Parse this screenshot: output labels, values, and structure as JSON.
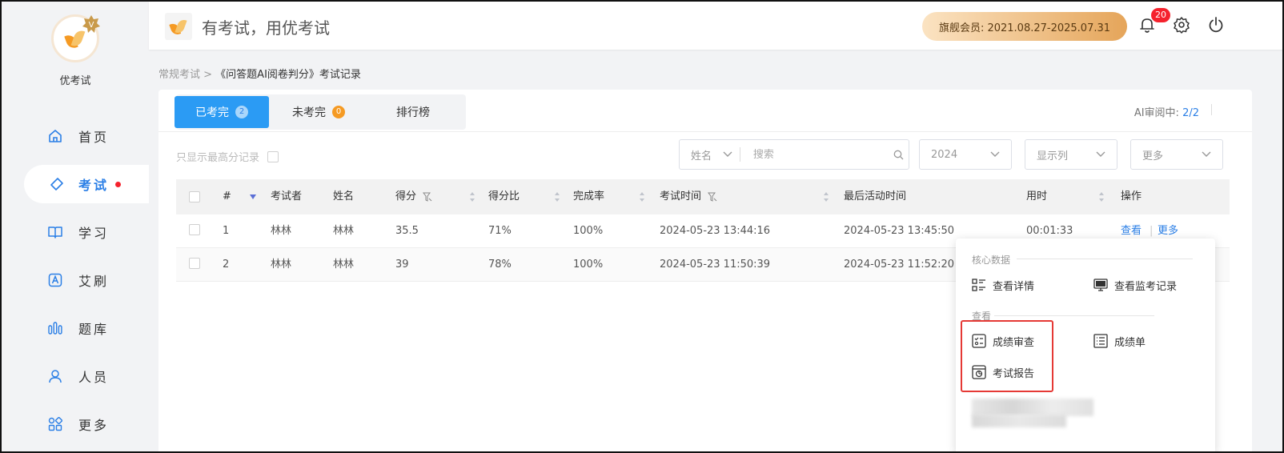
{
  "app": {
    "name": "优考试",
    "header_slogan": "有考试，用优考试"
  },
  "colors": {
    "primary": "#2b9bf4",
    "link": "#2b7fe6",
    "badge_red": "#f5222d",
    "badge_orange": "#f59a23",
    "member_gold": "#e5a55a"
  },
  "sidebar": {
    "items": [
      {
        "label": "首页",
        "icon": "home-icon"
      },
      {
        "label": "考试",
        "icon": "tag-icon",
        "active": true,
        "has_dot": true
      },
      {
        "label": "学习",
        "icon": "book-icon"
      },
      {
        "label": "艾刷",
        "icon": "letter-a-icon"
      },
      {
        "label": "题库",
        "icon": "bars-icon"
      },
      {
        "label": "人员",
        "icon": "user-icon"
      },
      {
        "label": "更多",
        "icon": "apps-icon"
      }
    ]
  },
  "header": {
    "member_label": "旗舰会员:  2021.08.27-2025.07.31",
    "notification_count": "20"
  },
  "breadcrumb": {
    "parent": "常规考试 > ",
    "current": "《问答题AI阅卷判分》考试记录"
  },
  "tabs": [
    {
      "label": "已考完",
      "count": "2",
      "active": true
    },
    {
      "label": "未考完",
      "count": "0"
    },
    {
      "label": "排行榜"
    }
  ],
  "ai_review": {
    "label": "AI审阅中: ",
    "value": "2/2"
  },
  "filters": {
    "only_highest": "只显示最高分记录",
    "search_field": "姓名",
    "search_placeholder": "搜索",
    "year": "2024",
    "columns": "显示列",
    "more": "更多"
  },
  "table": {
    "headers": [
      "#",
      "考试者",
      "姓名",
      "得分",
      "得分比",
      "完成率",
      "考试时间",
      "最后活动时间",
      "用时",
      "操作"
    ],
    "rows": [
      {
        "no": "1",
        "examinee": "林林",
        "name": "林林",
        "score": "35.5",
        "ratio": "71%",
        "completion": "100%",
        "exam_time": "2024-05-23 13:44:16",
        "last_active": "2024-05-23 13:45:50",
        "duration": "00:01:33",
        "view": "查看",
        "sep": "|",
        "more": "更多"
      },
      {
        "no": "2",
        "examinee": "林林",
        "name": "林林",
        "score": "39",
        "ratio": "78%",
        "completion": "100%",
        "exam_time": "2024-05-23 11:50:39",
        "last_active": "2024-05-23 11:52:20"
      }
    ]
  },
  "dropdown": {
    "section_core": "核心数据",
    "view_detail": "查看详情",
    "view_proctor": "查看监考记录",
    "section_view": "查看",
    "score_review": "成绩审查",
    "score_sheet": "成绩单",
    "exam_report": "考试报告"
  }
}
